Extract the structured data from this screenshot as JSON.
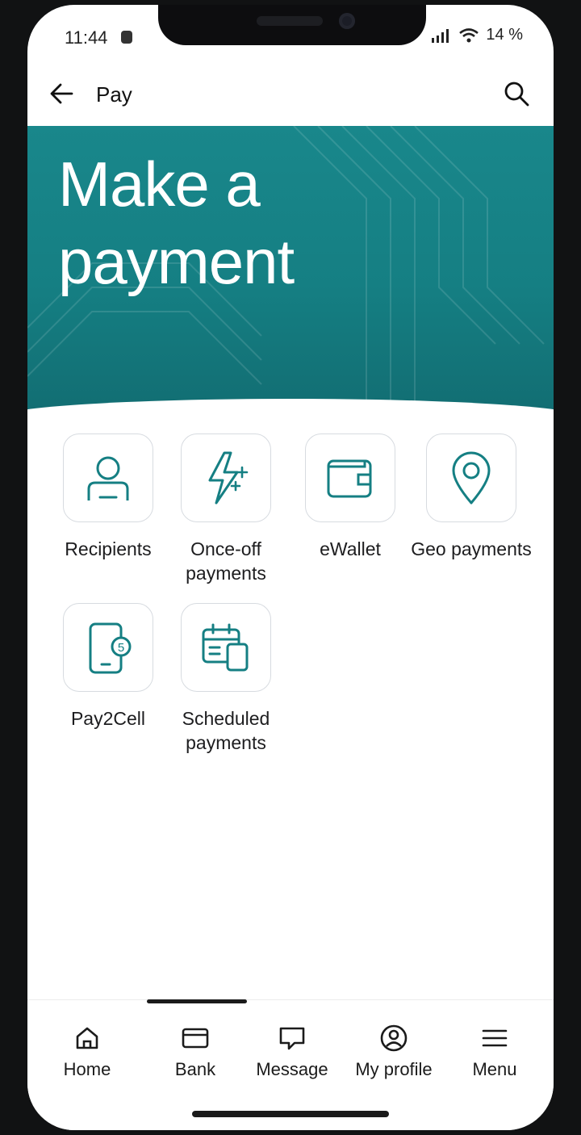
{
  "status_bar": {
    "time": "11:44",
    "battery": "14 %"
  },
  "app_bar": {
    "title": "Pay"
  },
  "hero": {
    "title": "Make a\npayment"
  },
  "tiles": [
    {
      "label": "Recipients",
      "icon": "person-icon"
    },
    {
      "label": "Once-off payments",
      "icon": "lightning-sparkle-icon"
    },
    {
      "label": "eWallet",
      "icon": "wallet-icon"
    },
    {
      "label": "Geo payments",
      "icon": "location-pin-icon"
    },
    {
      "label": "Pay2Cell",
      "icon": "phone-coin-icon"
    },
    {
      "label": "Scheduled payments",
      "icon": "calendar-phone-icon"
    }
  ],
  "bottom_nav": [
    {
      "label": "Home",
      "icon": "home-icon"
    },
    {
      "label": "Bank",
      "icon": "card-icon"
    },
    {
      "label": "Message",
      "icon": "chat-icon"
    },
    {
      "label": "My profile",
      "icon": "profile-icon"
    },
    {
      "label": "Menu",
      "icon": "menu-icon"
    }
  ],
  "colors": {
    "accent": "#157f83",
    "icon_stroke": "#157f83"
  }
}
